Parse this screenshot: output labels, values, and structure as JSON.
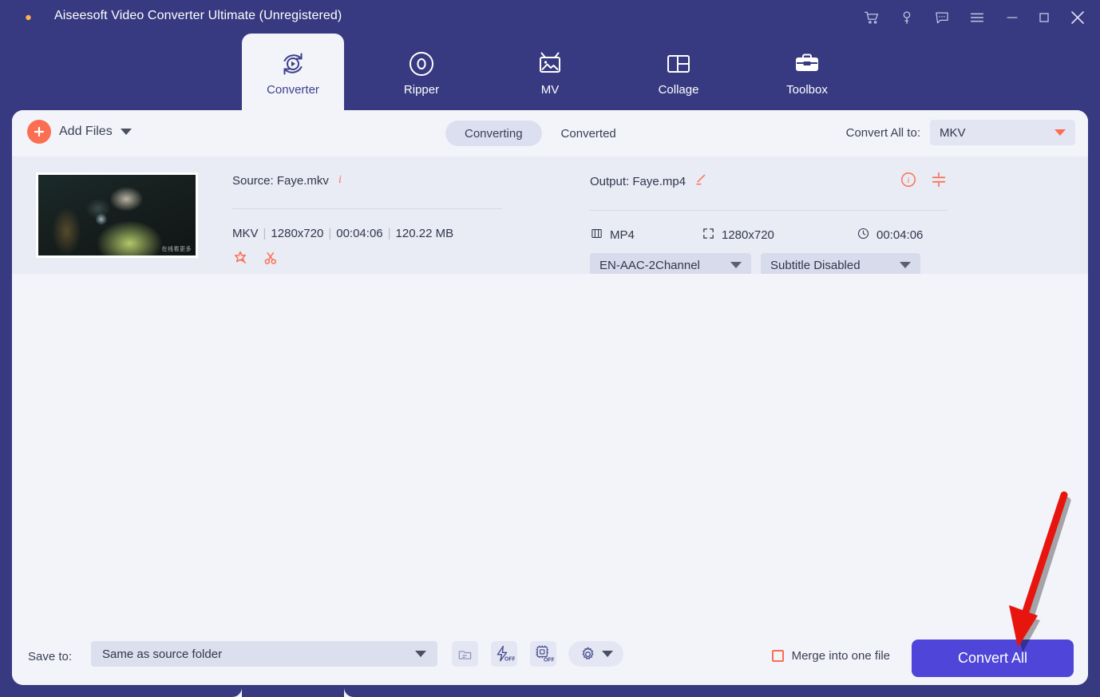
{
  "window": {
    "title": "Aiseesoft Video Converter Ultimate (Unregistered)",
    "accent_purple": "#4f46d9",
    "frame_color": "#373a80",
    "accent_orange": "#fc6e51",
    "controls": [
      {
        "name": "cart-icon",
        "label": "Cart"
      },
      {
        "name": "key-icon",
        "label": "Register"
      },
      {
        "name": "comment-icon",
        "label": "Feedback"
      },
      {
        "name": "menu-icon",
        "label": "Menu"
      },
      {
        "name": "minimize-icon",
        "label": "Minimize"
      },
      {
        "name": "maximize-icon",
        "label": "Maximize"
      },
      {
        "name": "close-icon",
        "label": "Close"
      }
    ]
  },
  "nav": {
    "tabs": [
      {
        "label": "Converter",
        "icon": "converter-icon",
        "active": true
      },
      {
        "label": "Ripper",
        "icon": "ripper-icon",
        "active": false
      },
      {
        "label": "MV",
        "icon": "mv-icon",
        "active": false
      },
      {
        "label": "Collage",
        "icon": "collage-icon",
        "active": false
      },
      {
        "label": "Toolbox",
        "icon": "toolbox-icon",
        "active": false
      }
    ]
  },
  "toolbar": {
    "add_files_label": "Add Files",
    "segment_tabs": [
      {
        "label": "Converting",
        "active": true
      },
      {
        "label": "Converted",
        "active": false
      }
    ],
    "convert_all_to_label": "Convert All to:",
    "convert_all_to_value": "MKV"
  },
  "file": {
    "source_label": "Source: Faye.mkv",
    "source_format": "MKV",
    "source_resolution": "1280x720",
    "source_duration": "00:04:06",
    "source_size": "120.22 MB",
    "thumbnail_watermark": "在线看更多",
    "output_label": "Output: Faye.mp4",
    "output_format": "MP4",
    "output_resolution": "1280x720",
    "output_duration": "00:04:06",
    "audio_track": "EN-AAC-2Channel",
    "subtitle_track": "Subtitle Disabled",
    "format_badge": "MP4"
  },
  "bottom": {
    "save_to_label": "Save to:",
    "save_to_value": "Same as source folder",
    "hardware_accel_label": "OFF",
    "gpu_accel_label": "OFF",
    "merge_label": "Merge into one file",
    "convert_all_label": "Convert All"
  }
}
